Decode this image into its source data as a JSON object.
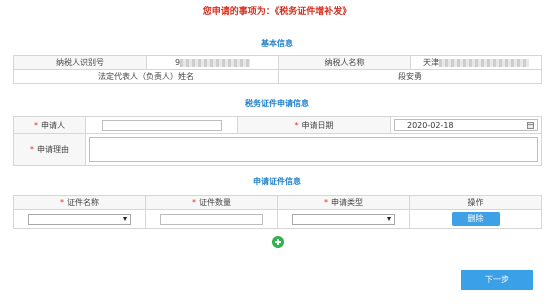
{
  "page_title": "您申请的事项为：《税务证件增补发》",
  "basic_info": {
    "section_title": "基本信息",
    "taxpayer_id_label": "纳税人识别号",
    "taxpayer_id_value": "9",
    "taxpayer_name_label": "纳税人名称",
    "taxpayer_name_value": "天津",
    "legal_rep_label": "法定代表人（负责人）姓名",
    "legal_rep_value": "段安勇"
  },
  "tax_cert_apply": {
    "section_title": "税务证件申请信息",
    "applicant_label": "申请人",
    "applicant_value": "",
    "apply_date_label": "申请日期",
    "apply_date_value": "2020-02-18",
    "reason_label": "申请理由",
    "reason_value": ""
  },
  "cert_info": {
    "section_title": "申请证件信息",
    "columns": [
      "证件名称",
      "证件数量",
      "申请类型",
      "操作"
    ],
    "rows": [
      {
        "cert_name": "",
        "cert_count": "",
        "apply_type": "",
        "action_label": "删除"
      }
    ]
  },
  "next_button_label": "下一步",
  "colors": {
    "title_red": "#d32f1f",
    "section_blue": "#1f7fc9",
    "button_blue": "#3ea1e6",
    "add_green": "#2fb34a",
    "required_star": "#e0312a"
  }
}
